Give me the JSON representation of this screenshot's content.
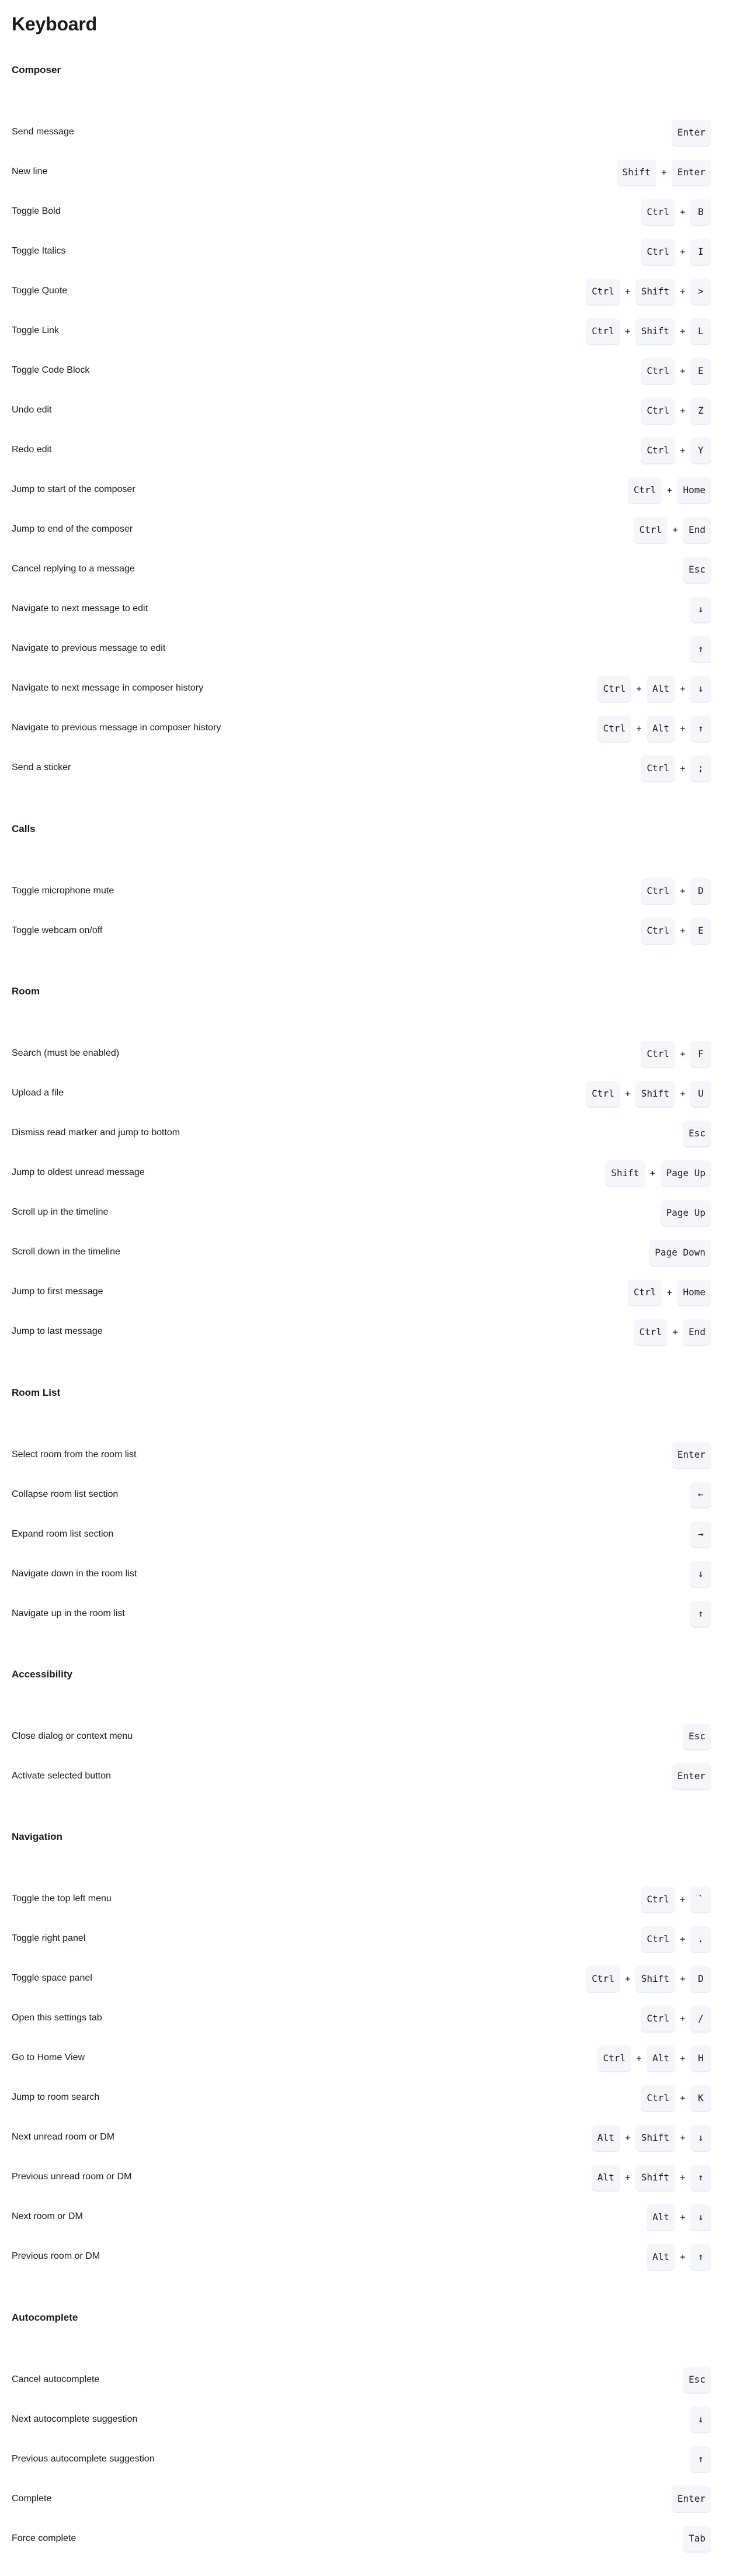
{
  "page": {
    "title": "Keyboard"
  },
  "sections": [
    {
      "title": "Composer",
      "shortcuts": [
        {
          "label": "Send message",
          "keys": [
            "Enter"
          ]
        },
        {
          "label": "New line",
          "keys": [
            "Shift",
            "Enter"
          ]
        },
        {
          "label": "Toggle Bold",
          "keys": [
            "Ctrl",
            "B"
          ]
        },
        {
          "label": "Toggle Italics",
          "keys": [
            "Ctrl",
            "I"
          ]
        },
        {
          "label": "Toggle Quote",
          "keys": [
            "Ctrl",
            "Shift",
            ">"
          ]
        },
        {
          "label": "Toggle Link",
          "keys": [
            "Ctrl",
            "Shift",
            "L"
          ]
        },
        {
          "label": "Toggle Code Block",
          "keys": [
            "Ctrl",
            "E"
          ]
        },
        {
          "label": "Undo edit",
          "keys": [
            "Ctrl",
            "Z"
          ]
        },
        {
          "label": "Redo edit",
          "keys": [
            "Ctrl",
            "Y"
          ]
        },
        {
          "label": "Jump to start of the composer",
          "keys": [
            "Ctrl",
            "Home"
          ]
        },
        {
          "label": "Jump to end of the composer",
          "keys": [
            "Ctrl",
            "End"
          ]
        },
        {
          "label": "Cancel replying to a message",
          "keys": [
            "Esc"
          ]
        },
        {
          "label": "Navigate to next message to edit",
          "keys": [
            "↓"
          ]
        },
        {
          "label": "Navigate to previous message to edit",
          "keys": [
            "↑"
          ]
        },
        {
          "label": "Navigate to next message in composer history",
          "keys": [
            "Ctrl",
            "Alt",
            "↓"
          ]
        },
        {
          "label": "Navigate to previous message in composer history",
          "keys": [
            "Ctrl",
            "Alt",
            "↑"
          ]
        },
        {
          "label": "Send a sticker",
          "keys": [
            "Ctrl",
            ";"
          ]
        }
      ]
    },
    {
      "title": "Calls",
      "shortcuts": [
        {
          "label": "Toggle microphone mute",
          "keys": [
            "Ctrl",
            "D"
          ]
        },
        {
          "label": "Toggle webcam on/off",
          "keys": [
            "Ctrl",
            "E"
          ]
        }
      ]
    },
    {
      "title": "Room",
      "shortcuts": [
        {
          "label": "Search (must be enabled)",
          "keys": [
            "Ctrl",
            "F"
          ]
        },
        {
          "label": "Upload a file",
          "keys": [
            "Ctrl",
            "Shift",
            "U"
          ]
        },
        {
          "label": "Dismiss read marker and jump to bottom",
          "keys": [
            "Esc"
          ]
        },
        {
          "label": "Jump to oldest unread message",
          "keys": [
            "Shift",
            "Page Up"
          ]
        },
        {
          "label": "Scroll up in the timeline",
          "keys": [
            "Page Up"
          ]
        },
        {
          "label": "Scroll down in the timeline",
          "keys": [
            "Page Down"
          ]
        },
        {
          "label": "Jump to first message",
          "keys": [
            "Ctrl",
            "Home"
          ]
        },
        {
          "label": "Jump to last message",
          "keys": [
            "Ctrl",
            "End"
          ]
        }
      ]
    },
    {
      "title": "Room List",
      "shortcuts": [
        {
          "label": "Select room from the room list",
          "keys": [
            "Enter"
          ]
        },
        {
          "label": "Collapse room list section",
          "keys": [
            "←"
          ]
        },
        {
          "label": "Expand room list section",
          "keys": [
            "→"
          ]
        },
        {
          "label": "Navigate down in the room list",
          "keys": [
            "↓"
          ]
        },
        {
          "label": "Navigate up in the room list",
          "keys": [
            "↑"
          ]
        }
      ]
    },
    {
      "title": "Accessibility",
      "shortcuts": [
        {
          "label": "Close dialog or context menu",
          "keys": [
            "Esc"
          ]
        },
        {
          "label": "Activate selected button",
          "keys": [
            "Enter"
          ]
        }
      ]
    },
    {
      "title": "Navigation",
      "shortcuts": [
        {
          "label": "Toggle the top left menu",
          "keys": [
            "Ctrl",
            "`"
          ]
        },
        {
          "label": "Toggle right panel",
          "keys": [
            "Ctrl",
            "."
          ]
        },
        {
          "label": "Toggle space panel",
          "keys": [
            "Ctrl",
            "Shift",
            "D"
          ]
        },
        {
          "label": "Open this settings tab",
          "keys": [
            "Ctrl",
            "/"
          ]
        },
        {
          "label": "Go to Home View",
          "keys": [
            "Ctrl",
            "Alt",
            "H"
          ]
        },
        {
          "label": "Jump to room search",
          "keys": [
            "Ctrl",
            "K"
          ]
        },
        {
          "label": "Next unread room or DM",
          "keys": [
            "Alt",
            "Shift",
            "↓"
          ]
        },
        {
          "label": "Previous unread room or DM",
          "keys": [
            "Alt",
            "Shift",
            "↑"
          ]
        },
        {
          "label": "Next room or DM",
          "keys": [
            "Alt",
            "↓"
          ]
        },
        {
          "label": "Previous room or DM",
          "keys": [
            "Alt",
            "↑"
          ]
        }
      ]
    },
    {
      "title": "Autocomplete",
      "shortcuts": [
        {
          "label": "Cancel autocomplete",
          "keys": [
            "Esc"
          ]
        },
        {
          "label": "Next autocomplete suggestion",
          "keys": [
            "↓"
          ]
        },
        {
          "label": "Previous autocomplete suggestion",
          "keys": [
            "↑"
          ]
        },
        {
          "label": "Complete",
          "keys": [
            "Enter"
          ]
        },
        {
          "label": "Force complete",
          "keys": [
            "Tab"
          ]
        }
      ]
    }
  ],
  "separator": "+",
  "colors": {
    "text": "#17191c",
    "key_background": "#f4f6fa",
    "key_shadow": "#e7ebf2",
    "page_background": "#ffffff"
  }
}
